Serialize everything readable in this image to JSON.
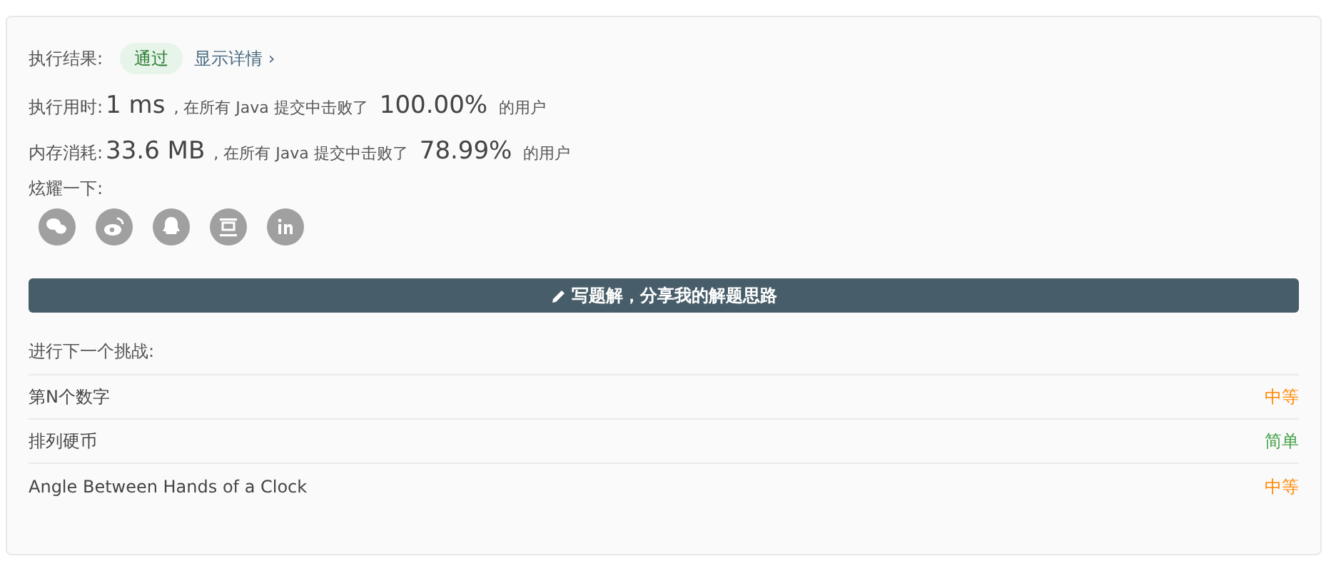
{
  "result": {
    "label": "执行结果:",
    "status": "通过",
    "details_link": "显示详情 ›"
  },
  "stats": [
    {
      "label": "执行用时:",
      "value": "1 ms",
      "middle": ", 在所有 Java 提交中击败了",
      "percent": "100.00%",
      "suffix": "的用户"
    },
    {
      "label": "内存消耗:",
      "value": "33.6 MB",
      "middle": ", 在所有 Java 提交中击败了",
      "percent": "78.99%",
      "suffix": "的用户"
    }
  ],
  "share": {
    "label": "炫耀一下:",
    "icons": [
      {
        "kind": "wechat"
      },
      {
        "kind": "weibo"
      },
      {
        "kind": "qq"
      },
      {
        "kind": "douban"
      },
      {
        "kind": "linkedin"
      }
    ]
  },
  "write_button": "写题解，分享我的解题思路",
  "next": {
    "label": "进行下一个挑战:",
    "problems": [
      {
        "title": "第N个数字",
        "difficulty": "中等",
        "color": "#ff8800"
      },
      {
        "title": "排列硬币",
        "difficulty": "简单",
        "color": "#43a047"
      },
      {
        "title": "Angle Between Hands of a Clock",
        "difficulty": "中等",
        "color": "#ff8800"
      }
    ]
  }
}
